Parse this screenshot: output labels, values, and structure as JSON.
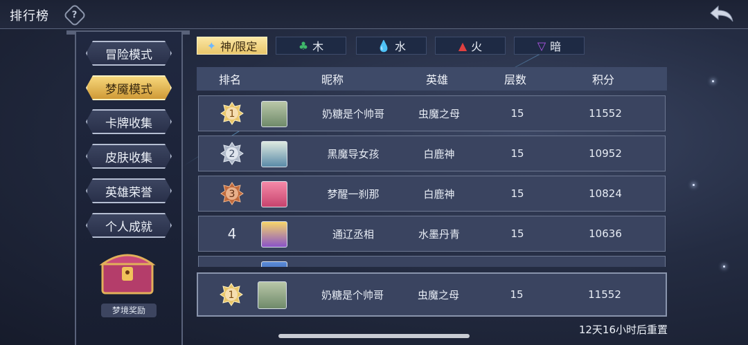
{
  "header": {
    "title": "排行榜",
    "help_icon": "?"
  },
  "sidebar": {
    "items": [
      {
        "label": "冒险模式",
        "active": false
      },
      {
        "label": "梦魇模式",
        "active": true
      },
      {
        "label": "卡牌收集",
        "active": false
      },
      {
        "label": "皮肤收集",
        "active": false
      },
      {
        "label": "英雄荣誉",
        "active": false
      },
      {
        "label": "个人成就",
        "active": false
      }
    ],
    "reward_label": "梦境奖励"
  },
  "tabs": [
    {
      "label": "神/限定",
      "icon": "sparkle-icon",
      "color": "#ffffff",
      "active": true
    },
    {
      "label": "木",
      "icon": "leaf-icon",
      "color": "#3fb86a",
      "active": false
    },
    {
      "label": "水",
      "icon": "water-drop-icon",
      "color": "#3fa3e8",
      "active": false
    },
    {
      "label": "火",
      "icon": "flame-icon",
      "color": "#e04040",
      "active": false
    },
    {
      "label": "暗",
      "icon": "dark-triangle-icon",
      "color": "#b057e8",
      "active": false
    }
  ],
  "table": {
    "headers": [
      "排名",
      "昵称",
      "英雄",
      "层数",
      "积分"
    ],
    "rows": [
      {
        "rank": "1",
        "nickname": "奶糖是个帅哥",
        "hero": "虫魔之母",
        "floor": "15",
        "score": "11552"
      },
      {
        "rank": "2",
        "nickname": "黑魔导女孩",
        "hero": "白鹿神",
        "floor": "15",
        "score": "10952"
      },
      {
        "rank": "3",
        "nickname": "梦醒一刹那",
        "hero": "白鹿神",
        "floor": "15",
        "score": "10824"
      },
      {
        "rank": "4",
        "nickname": "通辽丞相",
        "hero": "水墨丹青",
        "floor": "15",
        "score": "10636"
      }
    ]
  },
  "self": {
    "rank": "1",
    "nickname": "奶糖是个帅哥",
    "hero": "虫魔之母",
    "floor": "15",
    "score": "11552"
  },
  "reset_text": "12天16小时后重置",
  "colors": {
    "gold": "#e9c66a",
    "silver": "#aeb8c8",
    "bronze": "#c06a3c"
  }
}
